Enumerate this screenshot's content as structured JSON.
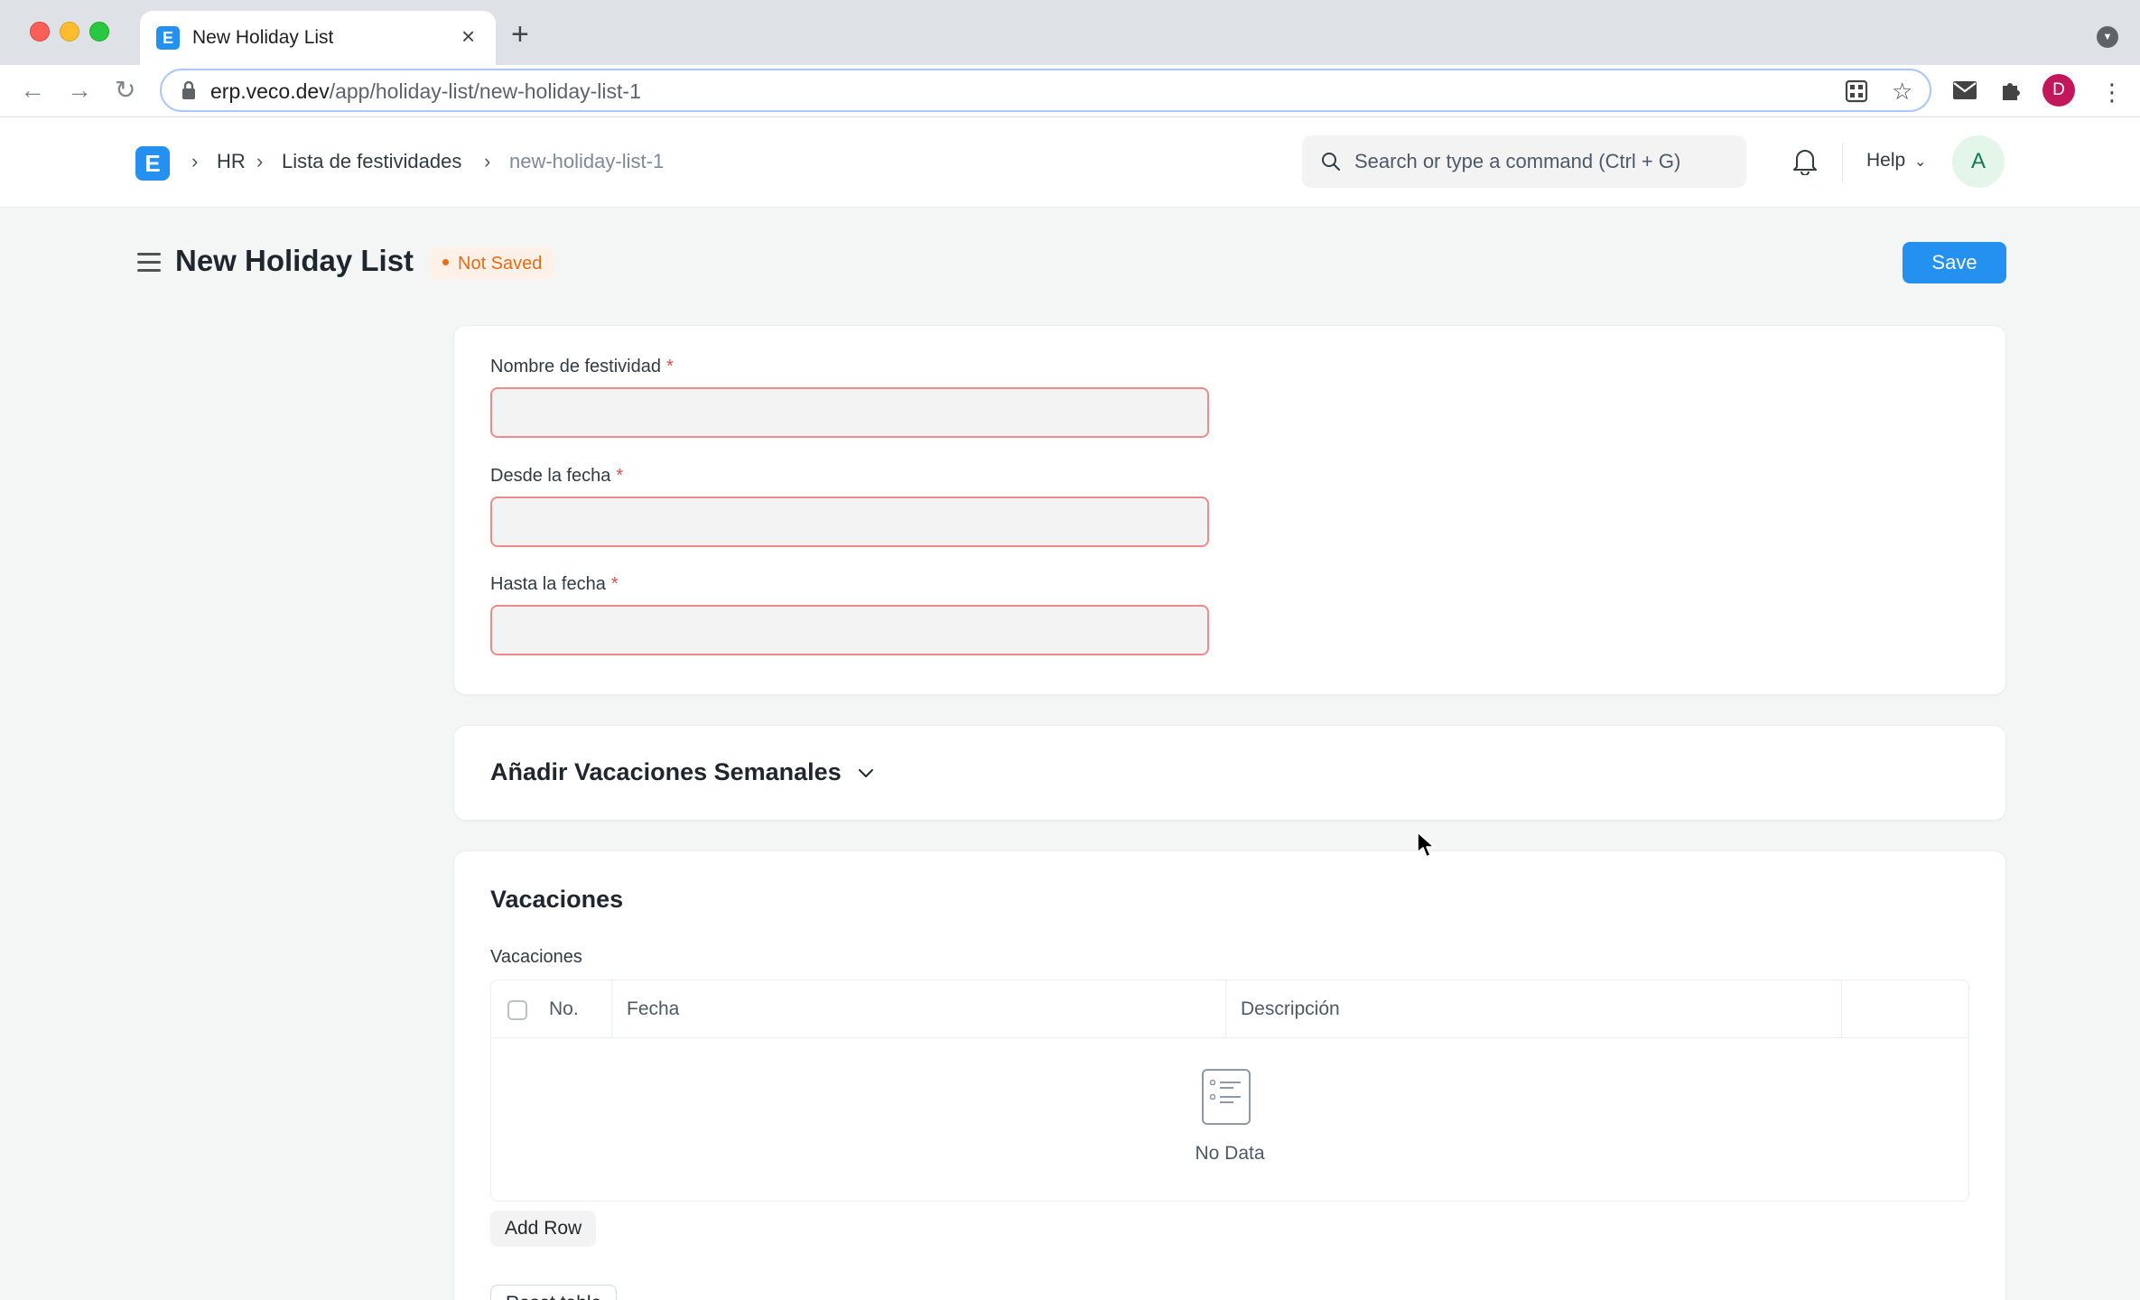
{
  "browser": {
    "tab_title": "New Holiday List",
    "tab_close": "×",
    "new_tab": "+",
    "url_host": "erp.veco.dev",
    "url_path": "/app/holiday-list/new-holiday-list-1",
    "profile_initial": "D"
  },
  "navbar": {
    "logo_letter": "E",
    "breadcrumbs": [
      "HR",
      "Lista de festividades",
      "new-holiday-list-1"
    ],
    "search_placeholder": "Search or type a command (Ctrl + G)",
    "help_label": "Help",
    "avatar_initial": "A"
  },
  "page": {
    "title": "New Holiday List",
    "status": "Not Saved",
    "save_label": "Save"
  },
  "form": {
    "fields": [
      {
        "label": "Nombre de festividad",
        "required": "*",
        "value": ""
      },
      {
        "label": "Desde la fecha",
        "required": "*",
        "value": ""
      },
      {
        "label": "Hasta la fecha",
        "required": "*",
        "value": ""
      }
    ]
  },
  "weekly_section": {
    "title": "Añadir Vacaciones Semanales"
  },
  "holidays_section": {
    "title": "Vacaciones",
    "table_label": "Vacaciones",
    "columns": [
      "No.",
      "Fecha",
      "Descripción"
    ],
    "empty_text": "No Data",
    "add_row_label": "Add Row",
    "next_button_label": "Reset table"
  },
  "colors": {
    "primary": "#2490ef",
    "status_orange": "#e86c13",
    "error_border": "#ed8a8a"
  }
}
